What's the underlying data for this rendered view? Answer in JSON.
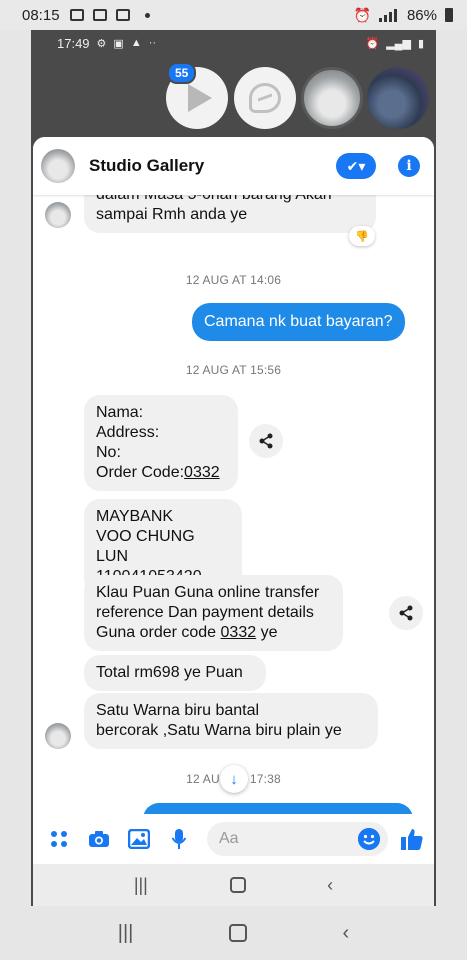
{
  "outer_status": {
    "time": "08:15",
    "battery": "86%"
  },
  "inner_status": {
    "time": "17:49"
  },
  "chat_heads": {
    "badge": "55"
  },
  "header": {
    "title": "Studio Gallery"
  },
  "messages": {
    "m1_line1": "dalam Masa 5-6hari barang Akan",
    "m1_line2": "sampai Rmh anda ye",
    "ts1": "12 AUG AT 14:06",
    "out1": "Camana nk buat bayaran?",
    "ts2": "12 AUG AT 15:56",
    "m2_l1": "Nama:",
    "m2_l2": "Address:",
    "m2_l3": "No:",
    "m2_l4_prefix": "Order Code:",
    "m2_l4_code": "0332",
    "m3_l1": "MAYBANK",
    "m3_l2": "VOO CHUNG LUN",
    "m3_l3": "110041053420",
    "m4_l1": "Klau Puan Guna online transfer",
    "m4_l2": "reference Dan payment details",
    "m4_l3_prefix": "Guna order code ",
    "m4_l3_code": "0332",
    "m4_l3_suffix": " ye",
    "m5": "Total rm698 ye Puan",
    "m6_l1": "Satu Warna biru bantal",
    "m6_l2": "bercorak ,Satu Warna biru plain ye",
    "ts3_left": "12 AU",
    "ts3_right": "17:38"
  },
  "composer": {
    "placeholder": "Aa"
  },
  "icons": {
    "apps": "apps-icon",
    "camera": "camera-icon",
    "gallery": "image-icon",
    "mic": "mic-icon",
    "emoji": "emoji-icon",
    "like": "thumbs-up-icon",
    "share": "share-icon",
    "info": "info-icon",
    "check": "check-icon"
  },
  "colors": {
    "accent": "#1877f2",
    "out_bubble": "#1f8be8",
    "in_bubble": "#f0f0f0"
  }
}
